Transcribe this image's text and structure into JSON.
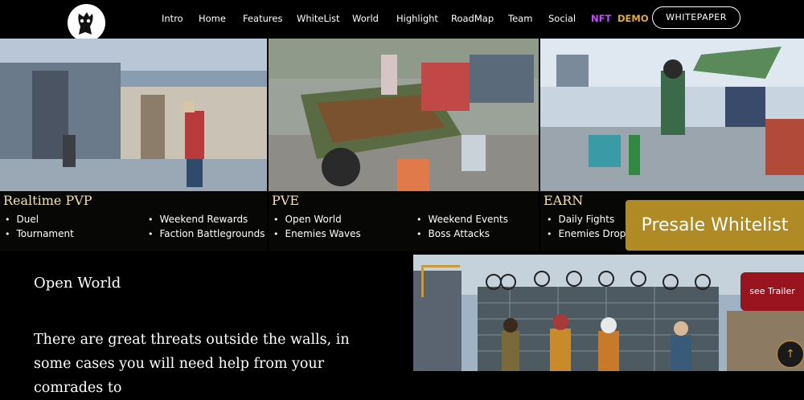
{
  "nav": {
    "items": [
      "Intro",
      "Home",
      "Features",
      "WhiteList",
      "World",
      "Highlight",
      "RoadMap",
      "Team",
      "Social"
    ],
    "nft": "NFT",
    "demo": "DEMO",
    "whitepaper": "WHITEPAPER"
  },
  "panels": [
    {
      "title": "Realtime PVP",
      "left": [
        "Duel",
        "Tournament"
      ],
      "right": [
        "Weekend Rewards",
        "Faction Battlegrounds"
      ]
    },
    {
      "title": "PVE",
      "left": [
        "Open World",
        "Enemies Waves"
      ],
      "right": [
        "Weekend Events",
        "Boss Attacks"
      ]
    },
    {
      "title": "EARN",
      "left": [
        "Daily Fights",
        "Enemies Drop"
      ],
      "right": []
    }
  ],
  "presale": "Presale Whitelist",
  "open_world": {
    "title": "Open World",
    "text": "There are great threats outside the walls, in some cases you will need help from your comrades to"
  },
  "trailer": "see Trailer",
  "scroll_top_icon": "arrow-up-icon",
  "colors": {
    "gold": "#b08a25",
    "nft": "#c74cff",
    "demo": "#e0aa3e",
    "trailer": "#9a1420"
  }
}
